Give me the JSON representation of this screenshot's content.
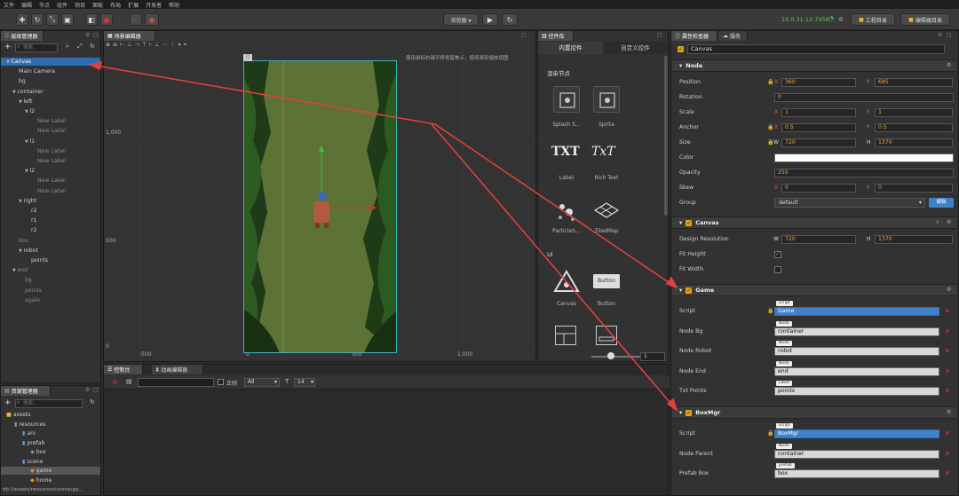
{
  "menu": [
    "文件",
    "编辑",
    "节点",
    "组件",
    "项目",
    "面板",
    "布局",
    "扩展",
    "开发者",
    "帮助"
  ],
  "toolbar": {
    "preview_device": "浏览器 ▾",
    "ip": "10.0.31.12:7456",
    "project_dir_btn": "工程目录",
    "editor_dir_btn": "编辑器目录"
  },
  "hierarchy": {
    "tab": "层级管理器",
    "search_placeholder": "搜索...",
    "items": [
      {
        "label": "Canvas",
        "indent": 0,
        "arrow": true,
        "selected": true,
        "dim": false
      },
      {
        "label": "Main Camera",
        "indent": 2,
        "arrow": false,
        "dim": false
      },
      {
        "label": "bg",
        "indent": 2,
        "arrow": false,
        "dim": false
      },
      {
        "label": "container",
        "indent": 1,
        "arrow": true,
        "dim": false
      },
      {
        "label": "left",
        "indent": 2,
        "arrow": true,
        "dim": false
      },
      {
        "label": "l2",
        "indent": 3,
        "arrow": true,
        "dim": false
      },
      {
        "label": "New Label",
        "indent": 5,
        "arrow": false,
        "dim": true
      },
      {
        "label": "New Label",
        "indent": 5,
        "arrow": false,
        "dim": true
      },
      {
        "label": "l1",
        "indent": 3,
        "arrow": true,
        "dim": false
      },
      {
        "label": "New Label",
        "indent": 5,
        "arrow": false,
        "dim": true
      },
      {
        "label": "New Label",
        "indent": 5,
        "arrow": false,
        "dim": true
      },
      {
        "label": "l2",
        "indent": 3,
        "arrow": true,
        "dim": false
      },
      {
        "label": "New Label",
        "indent": 5,
        "arrow": false,
        "dim": true
      },
      {
        "label": "New Label",
        "indent": 5,
        "arrow": false,
        "dim": true
      },
      {
        "label": "right",
        "indent": 2,
        "arrow": true,
        "dim": false
      },
      {
        "label": "r2",
        "indent": 4,
        "arrow": false,
        "dim": false
      },
      {
        "label": "r1",
        "indent": 4,
        "arrow": false,
        "dim": false
      },
      {
        "label": "r2",
        "indent": 4,
        "arrow": false,
        "dim": false
      },
      {
        "label": "box",
        "indent": 2,
        "arrow": false,
        "dim": true
      },
      {
        "label": "robot",
        "indent": 2,
        "arrow": true,
        "dim": false
      },
      {
        "label": "points",
        "indent": 4,
        "arrow": false,
        "dim": false
      },
      {
        "label": "end",
        "indent": 1,
        "arrow": true,
        "dim": true
      },
      {
        "label": "bg",
        "indent": 3,
        "arrow": false,
        "dim": true
      },
      {
        "label": "points",
        "indent": 3,
        "arrow": false,
        "dim": true
      },
      {
        "label": "again",
        "indent": 3,
        "arrow": false,
        "dim": true
      }
    ]
  },
  "scene": {
    "tab": "场景编辑器",
    "hint": "使用鼠标右键平移视窗焦点，使用滚轮缩放视图",
    "y_ticks": [
      "1,000",
      "500",
      "0"
    ],
    "x_ticks": [
      "-500",
      "0",
      "500",
      "1,000"
    ]
  },
  "widgets": {
    "tab": "控件库",
    "tab_builtin": "内置控件",
    "tab_custom": "自定义控件",
    "section_render": "渲染节点",
    "section_ui": "UI",
    "items": [
      "Splash S...",
      "Sprite",
      "Label",
      "Rich Text",
      "ParticleS...",
      "TiledMap",
      "Canvas",
      "Button"
    ],
    "glyph_txt": "TXT",
    "glyph_rich": "TxT",
    "button_sample": "Button",
    "zoom_value": "1"
  },
  "console": {
    "tab1": "控制台",
    "tab2": "动画编辑器",
    "regex_label": "正则",
    "level": "All",
    "font_size": "14"
  },
  "assets": {
    "tab": "资源管理器",
    "search_placeholder": "搜索...",
    "items": [
      {
        "label": "assets",
        "indent": 0
      },
      {
        "label": "resources",
        "indent": 1
      },
      {
        "label": "ani",
        "indent": 2
      },
      {
        "label": "prefab",
        "indent": 2
      },
      {
        "label": "box",
        "indent": 3
      },
      {
        "label": "scene",
        "indent": 2
      },
      {
        "label": "game",
        "indent": 3
      },
      {
        "label": "home",
        "indent": 3
      }
    ],
    "path": "db://assets/resources/scene/ga..."
  },
  "inspector": {
    "tab1": "属性检查器",
    "tab2": "服务",
    "node_name": "Canvas",
    "node_section": "Node",
    "position_label": "Position",
    "pos_x": "360",
    "pos_y": "685",
    "rotation_label": "Rotation",
    "rotation": "0",
    "scale_label": "Scale",
    "scale_x": "1",
    "scale_y": "1",
    "anchor_label": "Anchor",
    "anchor_x": "0.5",
    "anchor_y": "0.5",
    "size_label": "Size",
    "size_w": "720",
    "size_h": "1370",
    "color_label": "Color",
    "opacity_label": "Opacity",
    "opacity": "255",
    "skew_label": "Skew",
    "skew_x": "0",
    "skew_y": "0",
    "group_label": "Group",
    "group": "default",
    "edit_btn": "编辑",
    "canvas_section": "Canvas",
    "design_res_label": "Design Resolution",
    "design_w": "720",
    "design_h": "1370",
    "fit_height_label": "Fit Height",
    "fit_width_label": "Fit Width",
    "game_section": "Game",
    "script_label": "Script",
    "game_script": "Game",
    "script_tag": "script",
    "node_bg_label": "Node Bg",
    "node_bg": "container",
    "node_robot_label": "Node Robot",
    "node_robot": "robot",
    "node_end_label": "Node End",
    "node_end": "end",
    "txt_points_label": "Txt Points",
    "txt_points": "points",
    "node_tag": "Node",
    "label_tag": "Label",
    "boxmgr_section": "BoxMgr",
    "boxmgr_script": "BoxMgr",
    "node_parent_label": "Node Parent",
    "node_parent": "container",
    "prefab_box_label": "Prefab Box",
    "prefab_box": "box",
    "prefab_tag": "prefab",
    "axis_x": "X",
    "axis_y": "Y",
    "axis_w": "W",
    "axis_h": "H"
  },
  "colors": {
    "accent": "#3f82c9",
    "annotation": "#e04040",
    "field_text": "#f0a040"
  }
}
